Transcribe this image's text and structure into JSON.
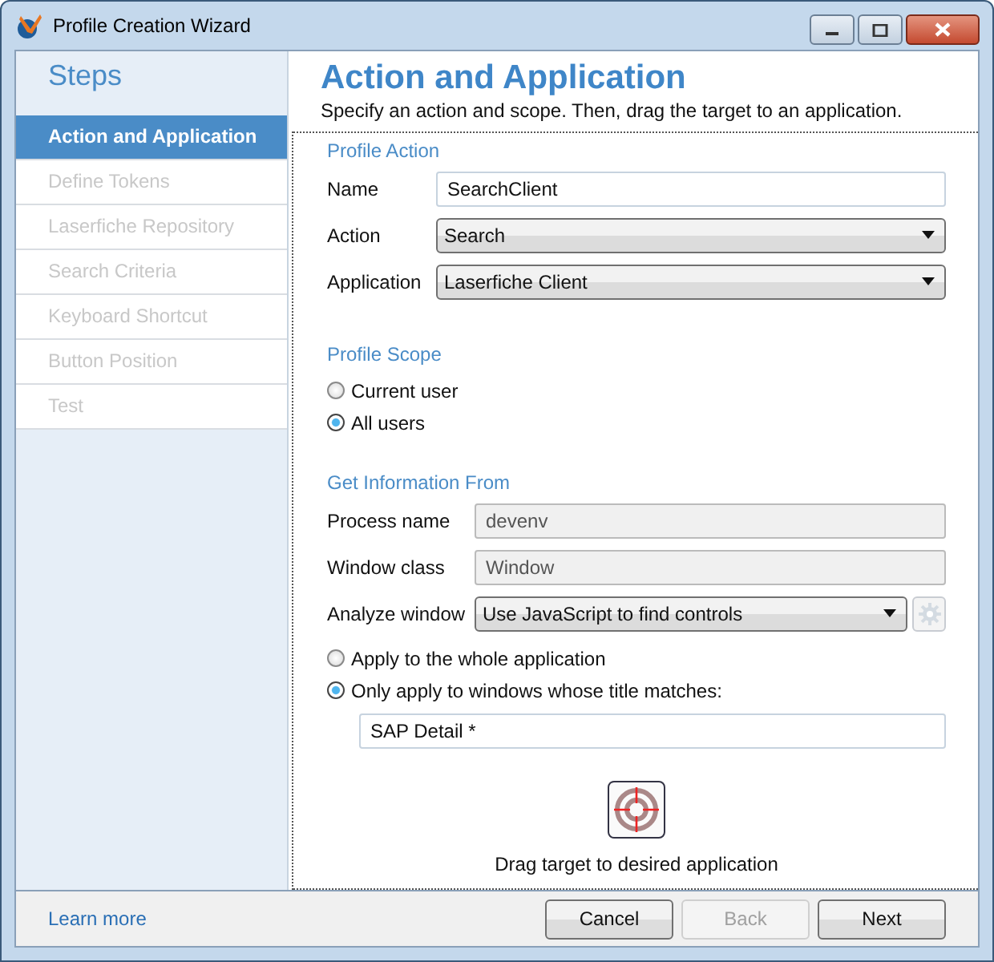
{
  "window": {
    "title": "Profile Creation Wizard"
  },
  "sidebar": {
    "title": "Steps",
    "items": [
      {
        "label": "Action and Application",
        "selected": true,
        "disabled": false
      },
      {
        "label": "Define Tokens",
        "selected": false,
        "disabled": true
      },
      {
        "label": "Laserfiche Repository",
        "selected": false,
        "disabled": true
      },
      {
        "label": "Search Criteria",
        "selected": false,
        "disabled": true
      },
      {
        "label": "Keyboard Shortcut",
        "selected": false,
        "disabled": true
      },
      {
        "label": "Button Position",
        "selected": false,
        "disabled": true
      },
      {
        "label": "Test",
        "selected": false,
        "disabled": true
      }
    ]
  },
  "page": {
    "title": "Action and Application",
    "subtitle": "Specify an action and scope. Then, drag the target to an application."
  },
  "profile_action": {
    "heading": "Profile Action",
    "fields": [
      {
        "label": "Name",
        "kind": "text",
        "value": "SearchClient",
        "disabled": false
      },
      {
        "label": "Action",
        "kind": "dropdown",
        "value": "Search",
        "disabled": false
      },
      {
        "label": "Application",
        "kind": "dropdown",
        "value": "Laserfiche Client",
        "disabled": false
      }
    ]
  },
  "profile_scope": {
    "heading": "Profile Scope",
    "options": [
      {
        "label": "Current user",
        "selected": false
      },
      {
        "label": "All users",
        "selected": true
      }
    ]
  },
  "get_information": {
    "heading": "Get Information From",
    "fields": [
      {
        "label": "Process name",
        "kind": "text",
        "value": "devenv",
        "disabled": true
      },
      {
        "label": "Window class",
        "kind": "text",
        "value": "Window",
        "disabled": true
      },
      {
        "label": "Analyze window",
        "kind": "dropdown",
        "value": "Use JavaScript to find controls",
        "disabled": false,
        "settings_disabled": true
      }
    ],
    "options": [
      {
        "label": "Apply to the whole application",
        "selected": false
      },
      {
        "label": "Only apply to windows whose title matches:",
        "selected": true
      }
    ],
    "title_match": "SAP Detail *"
  },
  "target": {
    "caption": "Drag target to desired application"
  },
  "footer": {
    "link": "Learn more",
    "buttons": [
      {
        "label": "Cancel",
        "disabled": false
      },
      {
        "label": "Back",
        "disabled": true
      },
      {
        "label": "Next",
        "disabled": false
      }
    ]
  }
}
